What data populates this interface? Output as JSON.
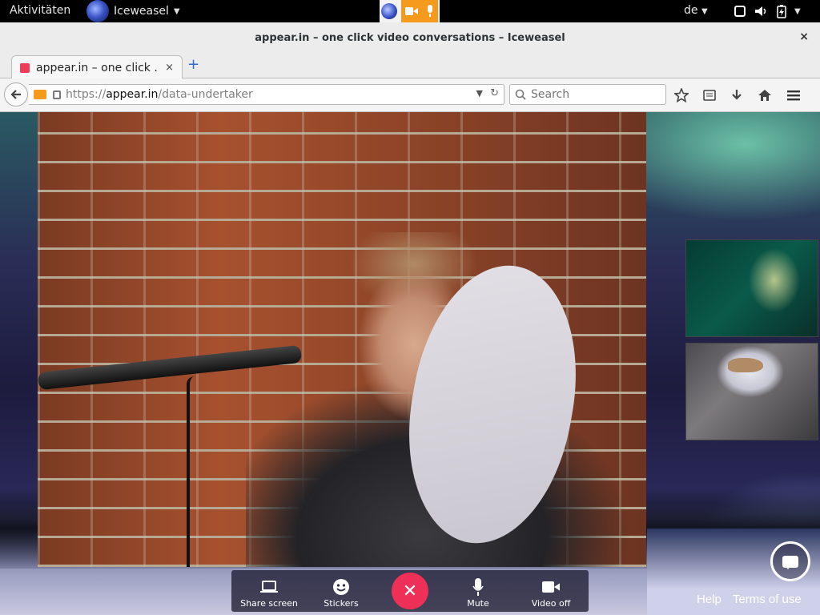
{
  "gnome_topbar": {
    "activities": "Aktivitäten",
    "app_name": "Iceweasel",
    "language": "de"
  },
  "window": {
    "title": "appear.in – one click video conversations – Iceweasel",
    "close_glyph": "×"
  },
  "tabs": [
    {
      "label": "appear.in – one click ...",
      "close_glyph": "×"
    }
  ],
  "new_tab_glyph": "+",
  "navbar": {
    "url_scheme": "https://",
    "url_host": "appear.in",
    "url_path": "/data-undertaker",
    "search_placeholder": "Search"
  },
  "controls": {
    "share_screen": "Share screen",
    "stickers": "Stickers",
    "mute": "Mute",
    "video_off": "Video off",
    "hangup_glyph": "✕"
  },
  "footer_links": {
    "help": "Help",
    "terms": "Terms of use"
  },
  "colors": {
    "accent_camera": "#f59a1c",
    "hangup": "#ee2f57",
    "tab_favicon": "#ee3b5a"
  },
  "icons": {
    "system": [
      "window-icon",
      "volume-icon",
      "battery-icon",
      "menu-caret-icon"
    ],
    "navbar": [
      "bookmark-star-icon",
      "reading-list-icon",
      "download-icon",
      "home-icon",
      "hamburger-menu-icon"
    ]
  }
}
